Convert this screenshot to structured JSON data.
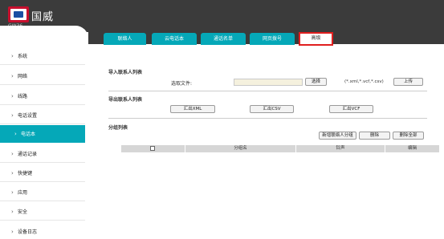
{
  "header": {
    "brand": "国威",
    "model": "GW36"
  },
  "sidebar": {
    "items": [
      {
        "label": "系统"
      },
      {
        "label": "网络"
      },
      {
        "label": "线路"
      },
      {
        "label": "电话设置"
      },
      {
        "label": "电话本"
      },
      {
        "label": "通话记录"
      },
      {
        "label": "快捷键"
      },
      {
        "label": "应用"
      },
      {
        "label": "安全"
      },
      {
        "label": "设备日志"
      }
    ],
    "active_index": 4
  },
  "tabs": [
    {
      "label": "联络人"
    },
    {
      "label": "云电话本"
    },
    {
      "label": "通话名单"
    },
    {
      "label": "网页拨号"
    },
    {
      "label": "高级"
    }
  ],
  "import_section": {
    "title": "导入联系人列表",
    "select_file_label": "选取文件:",
    "browse_button": "选择",
    "file_types": "(*.xml,*.vcf,*.csv)",
    "upload_button": "上传"
  },
  "export_section": {
    "title": "导出联系人列表",
    "buttons": [
      "汇出XML",
      "汇出CSV",
      "汇出VCF"
    ]
  },
  "group_section": {
    "title": "分组列表",
    "add_button": "新增联络人分组",
    "delete_button": "删除",
    "delete_all_button": "删除全部",
    "columns": [
      "",
      "分组名",
      "铃声",
      "编辑"
    ]
  }
}
